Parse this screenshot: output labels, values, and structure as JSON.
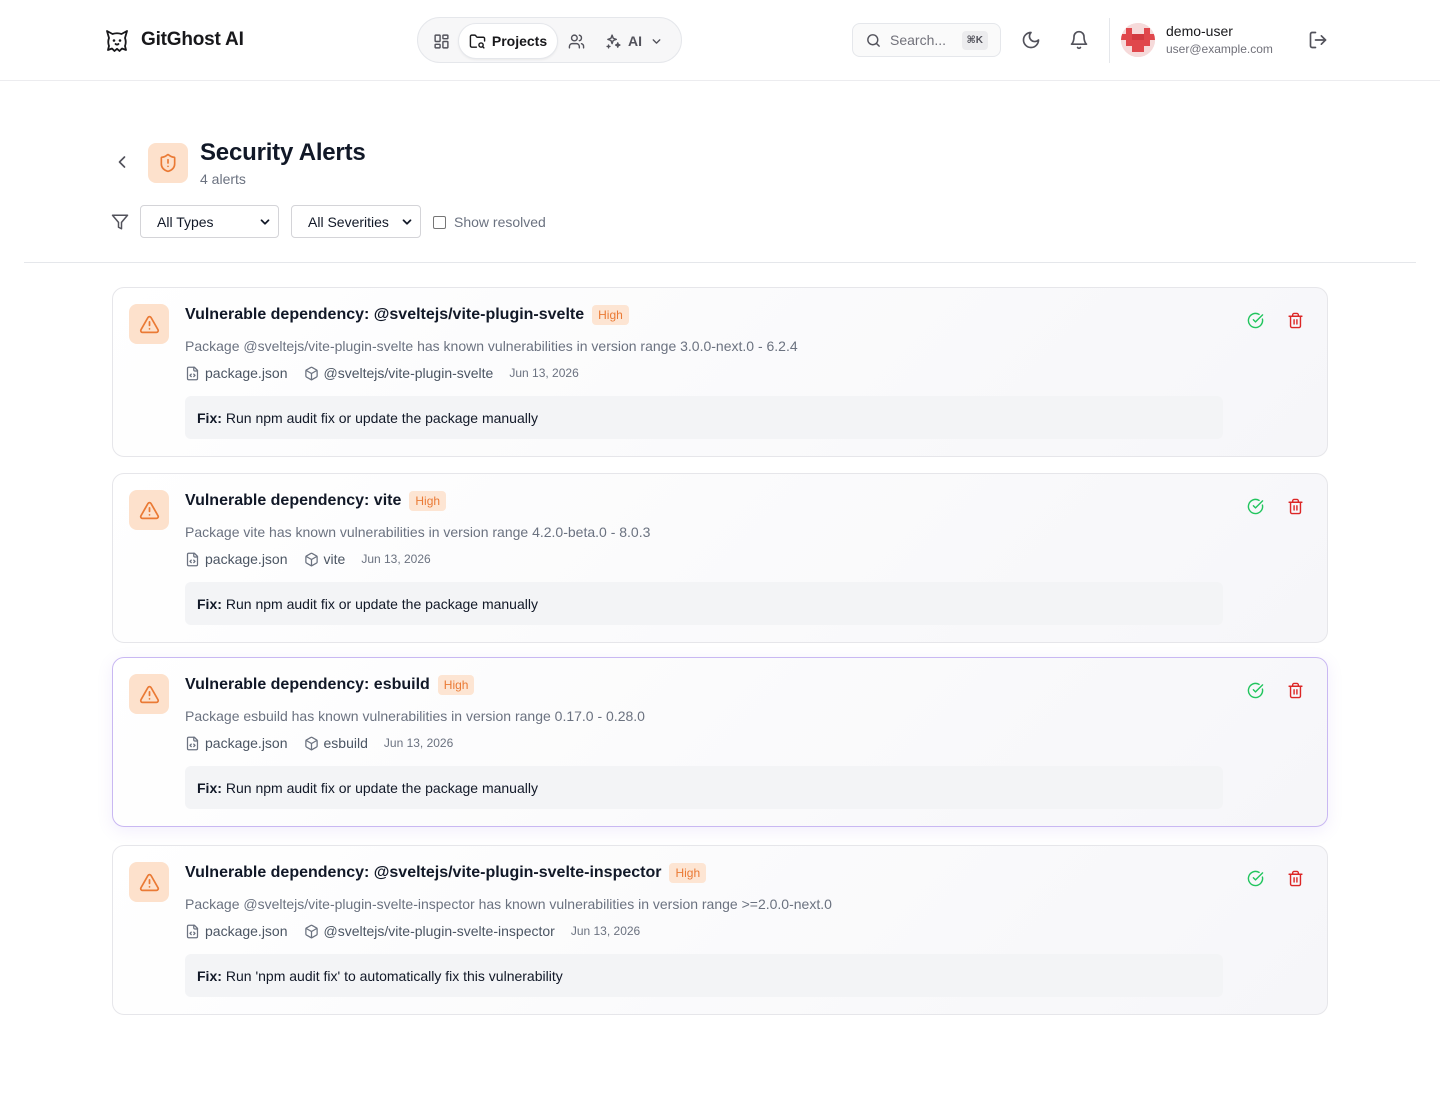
{
  "app": {
    "name": "GitGhost AI"
  },
  "nav": {
    "dashboard_icon": "grid-icon",
    "projects_label": "Projects",
    "team_icon": "users-icon",
    "ai_label": "AI"
  },
  "search": {
    "placeholder": "Search...",
    "shortcut": "⌘K"
  },
  "user": {
    "name": "demo-user",
    "email": "user@example.com"
  },
  "page": {
    "title": "Security Alerts",
    "count": "4 alerts"
  },
  "filters": {
    "type_selected": "All Types",
    "severity_selected": "All Severities",
    "show_resolved_label": "Show resolved",
    "show_resolved_checked": false
  },
  "colors": {
    "accent_orange": "#ea7a35",
    "badge_bg": "#fde5d3",
    "resolve_green": "#22c55e",
    "delete_red": "#dc2626",
    "focus_border": "#c9b8f2"
  },
  "alerts": [
    {
      "title": "Vulnerable dependency: @sveltejs/vite-plugin-svelte",
      "severity": "High",
      "description": "Package @sveltejs/vite-plugin-svelte has known vulnerabilities in version range 3.0.0-next.0 - 6.2.4",
      "file": "package.json",
      "package": "@sveltejs/vite-plugin-svelte",
      "date": "Jun 13, 2026",
      "fix_label": "Fix:",
      "fix": "Run npm audit fix or update the package manually"
    },
    {
      "title": "Vulnerable dependency: vite",
      "severity": "High",
      "description": "Package vite has known vulnerabilities in version range 4.2.0-beta.0 - 8.0.3",
      "file": "package.json",
      "package": "vite",
      "date": "Jun 13, 2026",
      "fix_label": "Fix:",
      "fix": "Run npm audit fix or update the package manually"
    },
    {
      "title": "Vulnerable dependency: esbuild",
      "severity": "High",
      "description": "Package esbuild has known vulnerabilities in version range 0.17.0 - 0.28.0",
      "file": "package.json",
      "package": "esbuild",
      "date": "Jun 13, 2026",
      "fix_label": "Fix:",
      "fix": "Run npm audit fix or update the package manually"
    },
    {
      "title": "Vulnerable dependency: @sveltejs/vite-plugin-svelte-inspector",
      "severity": "High",
      "description": "Package @sveltejs/vite-plugin-svelte-inspector has known vulnerabilities in version range >=2.0.0-next.0",
      "file": "package.json",
      "package": "@sveltejs/vite-plugin-svelte-inspector",
      "date": "Jun 13, 2026",
      "fix_label": "Fix:",
      "fix": "Run 'npm audit fix' to automatically fix this vulnerability"
    }
  ]
}
